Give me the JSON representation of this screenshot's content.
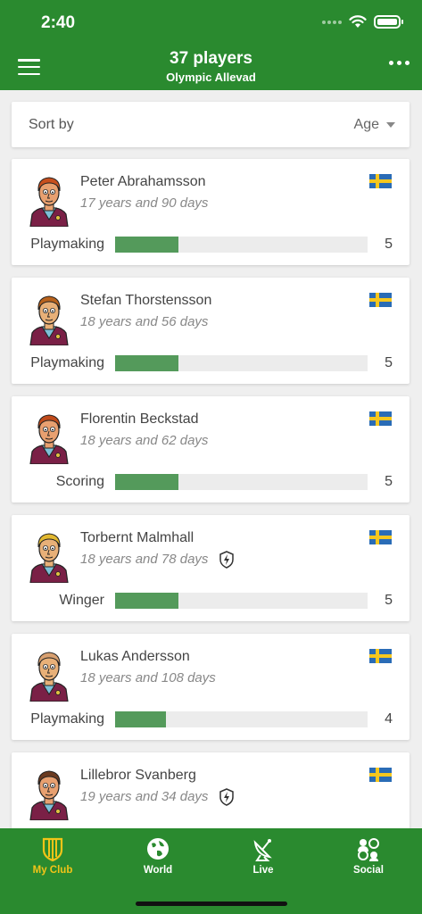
{
  "status_bar": {
    "time": "2:40"
  },
  "header": {
    "title": "37 players",
    "subtitle": "Olympic Allevad"
  },
  "sort": {
    "label": "Sort by",
    "value": "Age"
  },
  "players": [
    {
      "name": "Peter Abrahamsson",
      "age": "17 years and 90 days",
      "skill": "Playmaking",
      "level": 5,
      "specialty": "",
      "hair": "#c8501e",
      "skin": "#e8a070"
    },
    {
      "name": "Stefan Thorstensson",
      "age": "18 years and 56 days",
      "skill": "Playmaking",
      "level": 5,
      "specialty": "",
      "hair": "#b8621c",
      "skin": "#e8b078"
    },
    {
      "name": "Florentin Beckstad",
      "age": "18 years and 62 days",
      "skill": "Scoring",
      "level": 5,
      "specialty": "",
      "hair": "#c04a1a",
      "skin": "#e8a070"
    },
    {
      "name": "Torbernt Malmhall",
      "age": "18 years and 78 days",
      "skill": "Winger",
      "level": 5,
      "specialty": "quick-specialty-icon",
      "hair": "#e2b830",
      "skin": "#e8b078"
    },
    {
      "name": "Lukas Andersson",
      "age": "18 years and 108 days",
      "skill": "Playmaking",
      "level": 4,
      "specialty": "",
      "hair": "#d8a070",
      "skin": "#e8b078"
    },
    {
      "name": "Lillebror Svanberg",
      "age": "19 years and 34 days",
      "skill": "",
      "level": null,
      "specialty": "quick-specialty-icon",
      "hair": "#6a3a20",
      "skin": "#e8a070"
    }
  ],
  "max_level": 20,
  "flag": "sweden-flag-icon",
  "tabs": [
    {
      "label": "My Club",
      "icon": "shield-icon",
      "active": true
    },
    {
      "label": "World",
      "icon": "globe-icon",
      "active": false
    },
    {
      "label": "Live",
      "icon": "satellite-dish-icon",
      "active": false
    },
    {
      "label": "Social",
      "icon": "people-icon",
      "active": false
    }
  ],
  "colors": {
    "primary": "#2a8a2f",
    "bar": "#549a5b",
    "active_tab": "#f2c418",
    "flag_blue": "#2a6cb6",
    "flag_yellow": "#f6c71e"
  }
}
